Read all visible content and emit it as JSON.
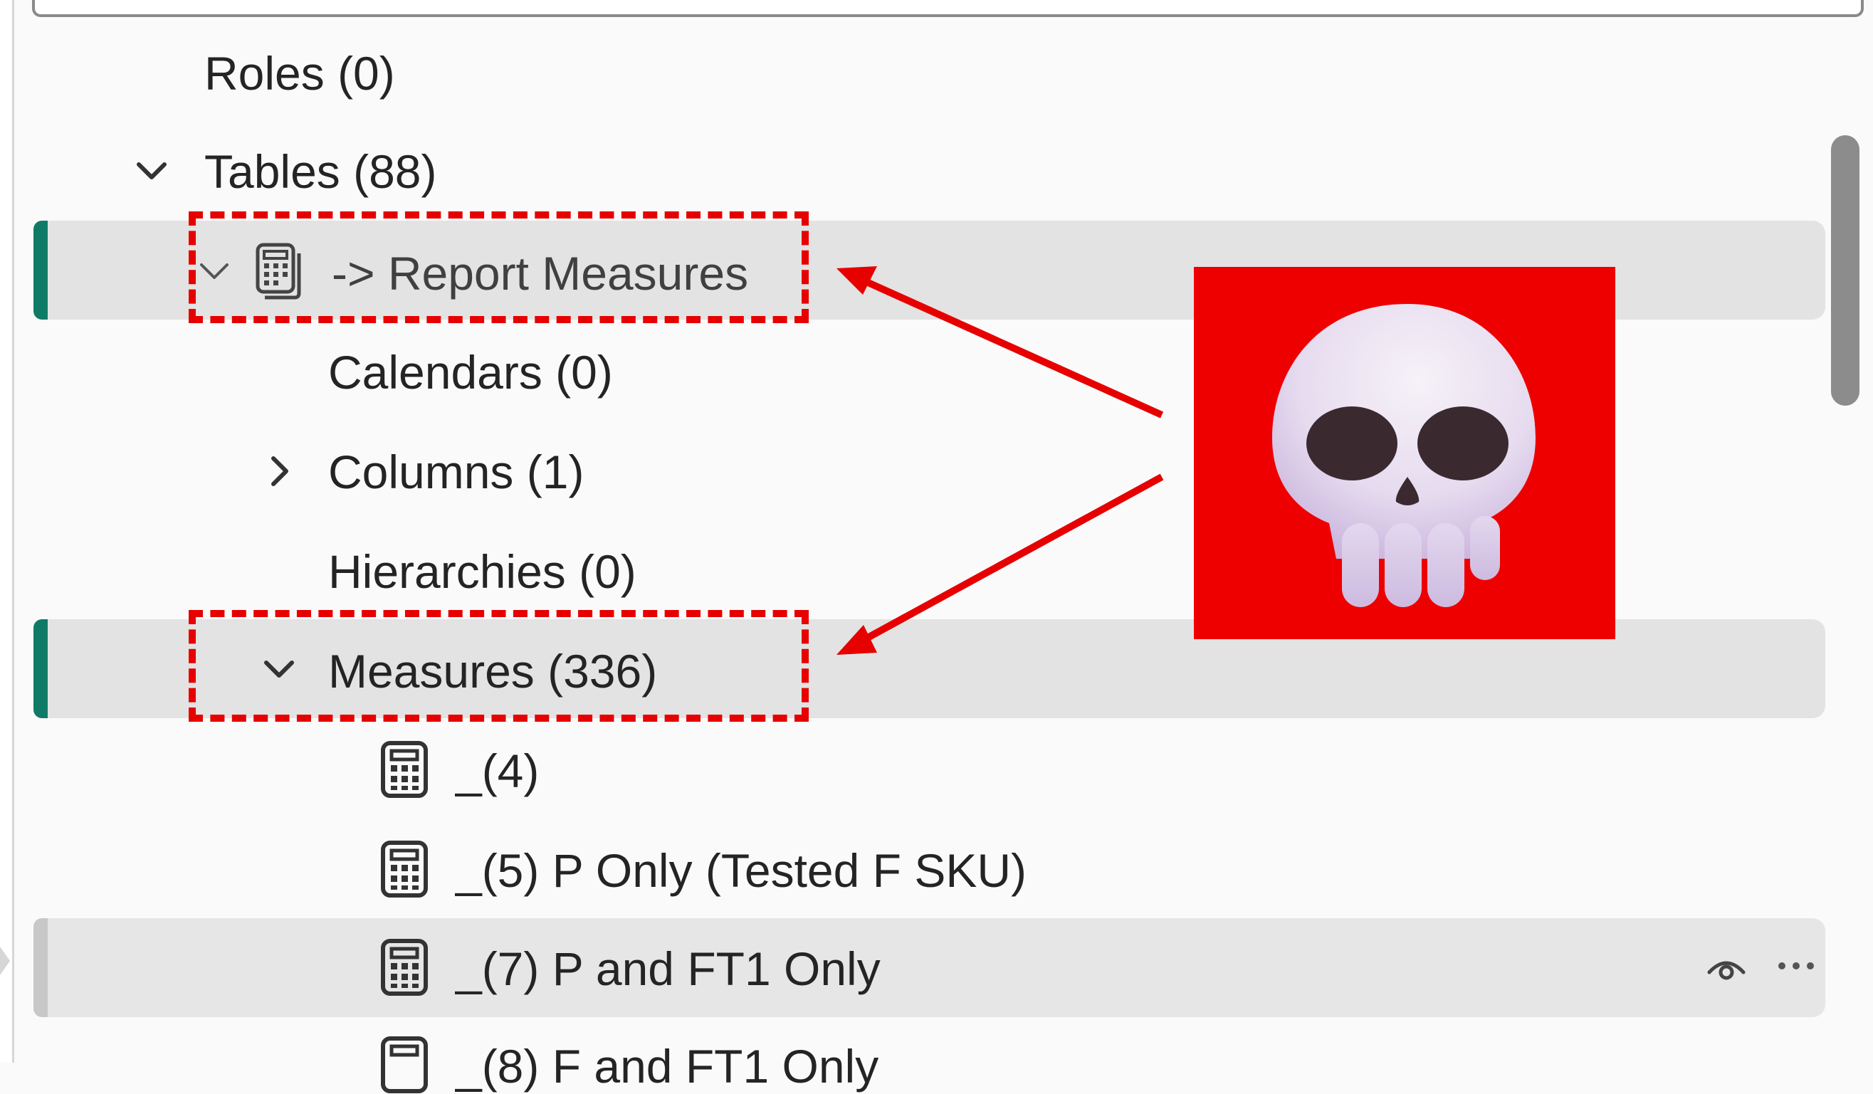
{
  "tree": {
    "roles": {
      "label": "Roles (0)"
    },
    "tables": {
      "label": "Tables (88)",
      "expanded": true
    },
    "report_measures": {
      "label": "-> Report Measures",
      "icon": "calculator-stack-icon",
      "expanded": true
    },
    "calendars": {
      "label": "Calendars (0)"
    },
    "columns": {
      "label": "Columns (1)",
      "expanded": false
    },
    "hierarchies": {
      "label": "Hierarchies (0)"
    },
    "measures": {
      "label": "Measures (336)",
      "expanded": true
    },
    "items": [
      {
        "label": "_(4)",
        "icon": "calculator-icon"
      },
      {
        "label": "_(5) P Only (Tested F SKU)",
        "icon": "calculator-icon"
      },
      {
        "label": "_(7) P and FT1 Only",
        "icon": "calculator-icon"
      },
      {
        "label": "_(8) F and FT1 Only",
        "icon": "calculator-icon"
      }
    ]
  },
  "row_actions": {
    "visibility_icon": "eye-icon",
    "more_icon": "ellipsis-icon"
  },
  "annotation": {
    "image": "skull-emoji",
    "background_color": "#ee0000",
    "arrow_color": "#e60000",
    "highlight_box_color": "#e60000"
  },
  "colors": {
    "accent": "#0f7b66",
    "selection": "#e3e3e3",
    "text": "#242424"
  }
}
